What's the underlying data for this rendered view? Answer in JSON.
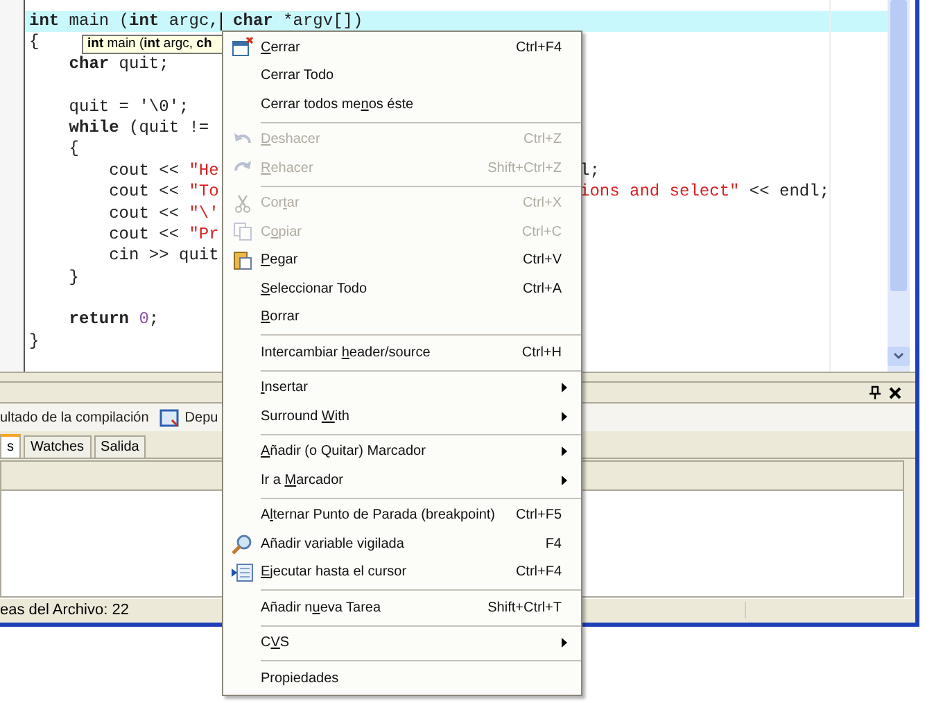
{
  "code_lines": [
    {
      "kind": "full",
      "highlighted": true,
      "tokens": [
        {
          "kind": "keyword",
          "text": "int"
        },
        {
          "kind": "plain",
          "text": " main ("
        },
        {
          "kind": "keyword",
          "text": "int"
        },
        {
          "kind": "plain",
          "text": " argc,"
        },
        {
          "kind": "caret"
        },
        {
          "kind": "keyword",
          "text": " char"
        },
        {
          "kind": "plain",
          "text": " *argv[])"
        }
      ]
    },
    {
      "kind": "split",
      "highlighted": false,
      "tokens": [
        {
          "kind": "plain",
          "text": "{"
        }
      ]
    },
    {
      "kind": "split",
      "highlighted": false,
      "tokens": [
        {
          "kind": "keyword",
          "text": "    char"
        },
        {
          "kind": "plain",
          "text": " quit;"
        }
      ]
    },
    {
      "kind": "blank",
      "highlighted": false
    },
    {
      "kind": "split",
      "highlighted": false,
      "tokens": [
        {
          "kind": "plain",
          "text": "    quit = '\\0';"
        }
      ]
    },
    {
      "kind": "split",
      "highlighted": false,
      "tokens": [
        {
          "kind": "keyword",
          "text": "    while"
        },
        {
          "kind": "plain",
          "text": " (quit !="
        }
      ]
    },
    {
      "kind": "split",
      "highlighted": false,
      "tokens": [
        {
          "kind": "plain",
          "text": "    {"
        }
      ]
    },
    {
      "kind": "split",
      "highlighted": false,
      "tokens": [
        {
          "kind": "plain",
          "text": "        cout << "
        },
        {
          "kind": "string",
          "text": "\"He"
        }
      ],
      "right": [
        {
          "kind": "plain",
          "text": "l;"
        }
      ]
    },
    {
      "kind": "split",
      "highlighted": false,
      "tokens": [
        {
          "kind": "plain",
          "text": "        cout << "
        },
        {
          "kind": "string",
          "text": "\"To"
        }
      ],
      "right": [
        {
          "kind": "string",
          "text": "ions and select\""
        },
        {
          "kind": "plain",
          "text": " << endl;"
        }
      ]
    },
    {
      "kind": "split",
      "highlighted": false,
      "tokens": [
        {
          "kind": "plain",
          "text": "        cout << "
        },
        {
          "kind": "string",
          "text": "\"\\'"
        }
      ]
    },
    {
      "kind": "split",
      "highlighted": false,
      "tokens": [
        {
          "kind": "plain",
          "text": "        cout << "
        },
        {
          "kind": "string",
          "text": "\"Pr"
        }
      ]
    },
    {
      "kind": "split",
      "highlighted": false,
      "tokens": [
        {
          "kind": "plain",
          "text": "        cin >> quit"
        }
      ]
    },
    {
      "kind": "split",
      "highlighted": false,
      "tokens": [
        {
          "kind": "plain",
          "text": "    }"
        }
      ]
    },
    {
      "kind": "blank",
      "highlighted": false
    },
    {
      "kind": "split",
      "highlighted": false,
      "tokens": [
        {
          "kind": "keyword",
          "text": "    return"
        },
        {
          "kind": "number",
          "text": " 0"
        },
        {
          "kind": "plain",
          "text": ";"
        }
      ]
    },
    {
      "kind": "split",
      "highlighted": false,
      "tokens": [
        {
          "kind": "plain",
          "text": "}"
        }
      ]
    }
  ],
  "tooltip": "**int** main (**int** argc, **ch**",
  "output_tabs": [
    "ultado de la compilación",
    "Depu"
  ],
  "debug_tabs": [
    {
      "label": "s",
      "selected": true
    },
    {
      "label": "Watches",
      "selected": false
    },
    {
      "label": "Salida",
      "selected": false
    }
  ],
  "status_bar": "eas del Archivo: 22",
  "context_menu": [
    {
      "kind": "item",
      "label_parts": [
        {
          "text": "C",
          "underlined": true
        },
        {
          "text": "errar",
          "underlined": false
        }
      ],
      "shortcut": "Ctrl+F4",
      "disabled": false
    },
    {
      "kind": "item",
      "label_parts": [
        {
          "text": "Cerrar Todo",
          "underlined": false
        }
      ],
      "disabled": false
    },
    {
      "kind": "item",
      "label_parts": [
        {
          "text": "Cerrar todos me",
          "underlined": false
        },
        {
          "text": "n",
          "underlined": true
        },
        {
          "text": "os éste",
          "underlined": false
        }
      ],
      "disabled": false
    },
    {
      "kind": "separator"
    },
    {
      "kind": "item",
      "label_parts": [
        {
          "text": "D",
          "underlined": true
        },
        {
          "text": "eshacer",
          "underlined": false
        }
      ],
      "shortcut": "Ctrl+Z",
      "disabled": true
    },
    {
      "kind": "item",
      "label_parts": [
        {
          "text": "R",
          "underlined": true
        },
        {
          "text": "ehacer",
          "underlined": false
        }
      ],
      "shortcut": "Shift+Ctrl+Z",
      "disabled": true
    },
    {
      "kind": "separator"
    },
    {
      "kind": "item",
      "label_parts": [
        {
          "text": "Cor",
          "underlined": false
        },
        {
          "text": "t",
          "underlined": true
        },
        {
          "text": "ar",
          "underlined": false
        }
      ],
      "shortcut": "Ctrl+X",
      "disabled": true
    },
    {
      "kind": "item",
      "label_parts": [
        {
          "text": "C",
          "underlined": false
        },
        {
          "text": "o",
          "underlined": true
        },
        {
          "text": "piar",
          "underlined": false
        }
      ],
      "shortcut": "Ctrl+C",
      "disabled": true
    },
    {
      "kind": "item",
      "label_parts": [
        {
          "text": "P",
          "underlined": true
        },
        {
          "text": "egar",
          "underlined": false
        }
      ],
      "shortcut": "Ctrl+V",
      "disabled": false
    },
    {
      "kind": "item",
      "label_parts": [
        {
          "text": "S",
          "underlined": true
        },
        {
          "text": "eleccionar Todo",
          "underlined": false
        }
      ],
      "shortcut": "Ctrl+A",
      "disabled": false
    },
    {
      "kind": "item",
      "label_parts": [
        {
          "text": "B",
          "underlined": true
        },
        {
          "text": "orrar",
          "underlined": false
        }
      ],
      "disabled": false
    },
    {
      "kind": "separator"
    },
    {
      "kind": "item",
      "label_parts": [
        {
          "text": "Intercambiar ",
          "underlined": false
        },
        {
          "text": "h",
          "underlined": true
        },
        {
          "text": "eader/source",
          "underlined": false
        }
      ],
      "shortcut": "Ctrl+H",
      "disabled": false
    },
    {
      "kind": "separator"
    },
    {
      "kind": "submenu",
      "label_parts": [
        {
          "text": "I",
          "underlined": true
        },
        {
          "text": "nsertar",
          "underlined": false
        }
      ],
      "disabled": false
    },
    {
      "kind": "submenu",
      "label_parts": [
        {
          "text": "Surround ",
          "underlined": false
        },
        {
          "text": "W",
          "underlined": true
        },
        {
          "text": "ith",
          "underlined": false
        }
      ],
      "disabled": false
    },
    {
      "kind": "separator"
    },
    {
      "kind": "submenu",
      "label_parts": [
        {
          "text": "A",
          "underlined": true
        },
        {
          "text": "ñadir (o Quitar) Marcador",
          "underlined": false
        }
      ],
      "disabled": false
    },
    {
      "kind": "submenu",
      "label_parts": [
        {
          "text": "Ir a ",
          "underlined": false
        },
        {
          "text": "M",
          "underlined": true
        },
        {
          "text": "arcador",
          "underlined": false
        }
      ],
      "disabled": false
    },
    {
      "kind": "separator"
    },
    {
      "kind": "item",
      "label_parts": [
        {
          "text": "A",
          "underlined": false
        },
        {
          "text": "l",
          "underlined": true
        },
        {
          "text": "ternar Punto de Parada (breakpoint)",
          "underlined": false
        }
      ],
      "shortcut": "Ctrl+F5",
      "disabled": false
    },
    {
      "kind": "item",
      "label_parts": [
        {
          "text": "Añadir variable vigilada",
          "underlined": false
        }
      ],
      "shortcut": "F4",
      "disabled": false
    },
    {
      "kind": "item",
      "label_parts": [
        {
          "text": "E",
          "underlined": true
        },
        {
          "text": "jecutar hasta el cursor",
          "underlined": false
        }
      ],
      "shortcut": "Ctrl+F4",
      "disabled": false
    },
    {
      "kind": "separator"
    },
    {
      "kind": "item",
      "label_parts": [
        {
          "text": "Añadir n",
          "underlined": false
        },
        {
          "text": "u",
          "underlined": true
        },
        {
          "text": "eva Tarea",
          "underlined": false
        }
      ],
      "shortcut": "Shift+Ctrl+T",
      "disabled": false
    },
    {
      "kind": "separator"
    },
    {
      "kind": "submenu",
      "label_parts": [
        {
          "text": "C",
          "underlined": false
        },
        {
          "text": "V",
          "underlined": true
        },
        {
          "text": "S",
          "underlined": false
        }
      ],
      "disabled": false
    },
    {
      "kind": "separator"
    },
    {
      "kind": "item",
      "label_parts": [
        {
          "text": "Propiedades",
          "underlined": false
        }
      ],
      "disabled": false
    }
  ]
}
